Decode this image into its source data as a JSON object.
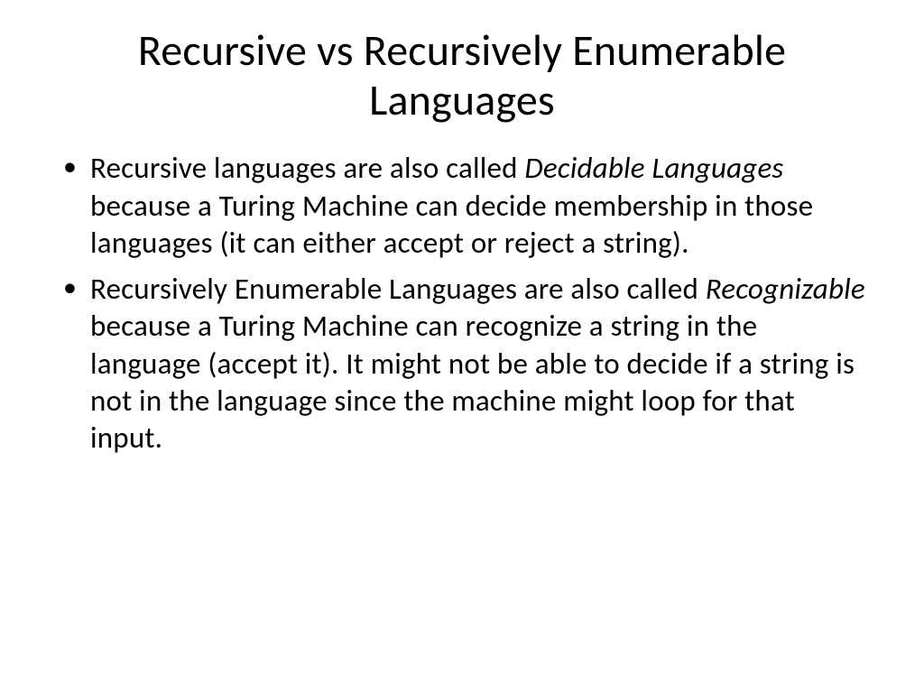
{
  "slide": {
    "title": "Recursive vs Recursively Enumerable Languages",
    "bullets": [
      {
        "pre1": "Recursive languages are also called ",
        "em1": "Decidable Languages",
        "post1": " because a Turing Machine can decide membership in those languages (it can either accept or reject a string)."
      },
      {
        "pre1": "Recursively Enumerable Languages are also called ",
        "em1": "Recognizable",
        "post1": " because a Turing Machine can recognize a string in the language (accept it). It might not be able to decide if a string is not in the language since the machine might loop for that input."
      }
    ]
  }
}
